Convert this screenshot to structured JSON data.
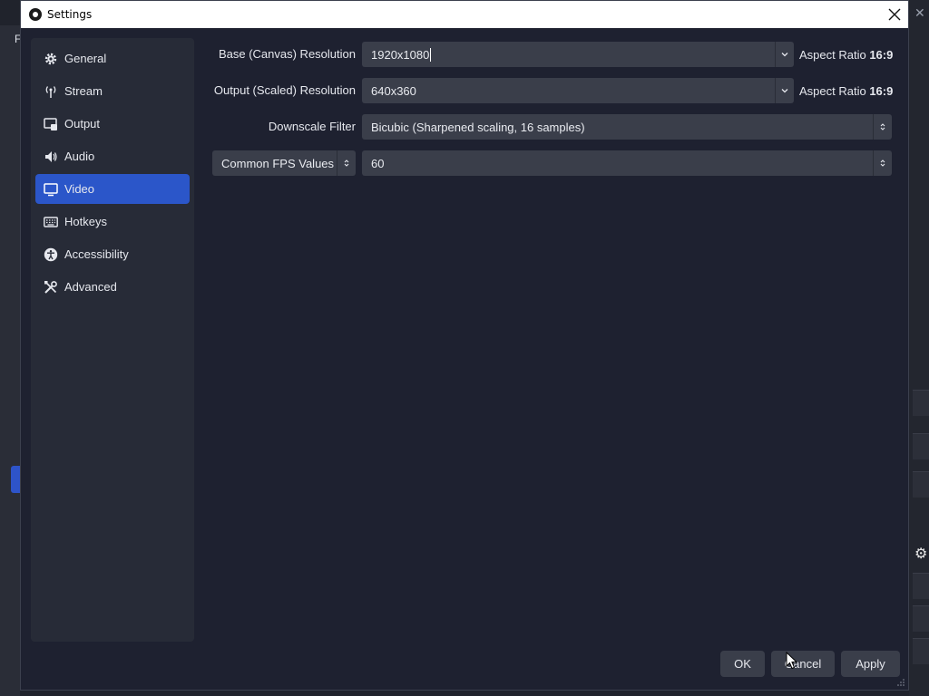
{
  "window": {
    "title": "Settings",
    "close_icon": "close-icon"
  },
  "background": {
    "menu_letter": "F"
  },
  "sidebar": {
    "items": [
      {
        "label": "General",
        "icon": "gear-icon",
        "active": false
      },
      {
        "label": "Stream",
        "icon": "antenna-icon",
        "active": false
      },
      {
        "label": "Output",
        "icon": "output-icon",
        "active": false
      },
      {
        "label": "Audio",
        "icon": "speaker-icon",
        "active": false
      },
      {
        "label": "Video",
        "icon": "monitor-icon",
        "active": true
      },
      {
        "label": "Hotkeys",
        "icon": "keyboard-icon",
        "active": false
      },
      {
        "label": "Accessibility",
        "icon": "accessibility-icon",
        "active": false
      },
      {
        "label": "Advanced",
        "icon": "tools-icon",
        "active": false
      }
    ]
  },
  "video": {
    "base_resolution": {
      "label": "Base (Canvas) Resolution",
      "value": "1920x1080",
      "aspect_label": "Aspect Ratio",
      "aspect_value": "16:9"
    },
    "output_resolution": {
      "label": "Output (Scaled) Resolution",
      "value": "640x360",
      "aspect_label": "Aspect Ratio",
      "aspect_value": "16:9"
    },
    "downscale_filter": {
      "label": "Downscale Filter",
      "value": "Bicubic (Sharpened scaling, 16 samples)"
    },
    "fps": {
      "type_value": "Common FPS Values",
      "value": "60"
    }
  },
  "buttons": {
    "ok": "OK",
    "cancel": "Cancel",
    "apply": "Apply"
  },
  "colors": {
    "accent": "#2b56c9",
    "panel": "#272b37",
    "field": "#3a3e4a",
    "dialog_bg": "#1e2130"
  }
}
